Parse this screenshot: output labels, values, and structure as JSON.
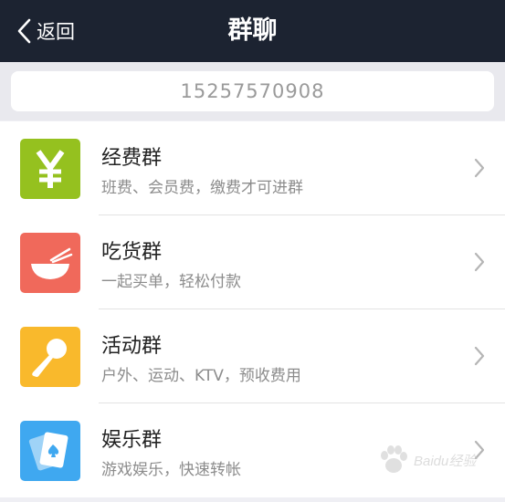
{
  "nav": {
    "back_label": "返回",
    "title": "群聊"
  },
  "search": {
    "value": "15257570908"
  },
  "groups": [
    {
      "name": "经费群",
      "desc": "班费、会员费，缴费才可进群",
      "icon": "yen-icon",
      "color": "#95c11f"
    },
    {
      "name": "吃货群",
      "desc": "一起买单，轻松付款",
      "icon": "bowl-chopsticks-icon",
      "color": "#f0695b"
    },
    {
      "name": "活动群",
      "desc": "户外、运动、KTV，预收费用",
      "icon": "microphone-icon",
      "color": "#f9b92c"
    },
    {
      "name": "娱乐群",
      "desc": "游戏娱乐，快速转帐",
      "icon": "playing-cards-icon",
      "color": "#3fa8f0"
    }
  ],
  "watermark": {
    "text": "Baidu经验"
  }
}
